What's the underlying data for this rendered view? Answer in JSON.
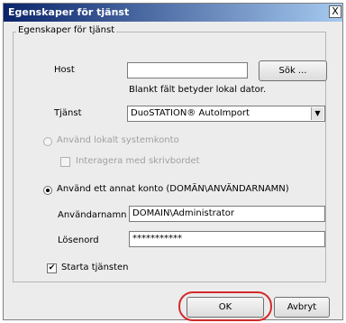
{
  "window": {
    "title": "Egenskaper för tjänst",
    "close_glyph": "X"
  },
  "group": {
    "legend": "Egenskaper för tjänst"
  },
  "host": {
    "label": "Host",
    "value": "",
    "hint": "Blankt fält betyder lokal dator.",
    "browse_button": "Sök ..."
  },
  "service": {
    "label": "Tjänst",
    "selected": "DuoSTATION® AutoImport",
    "arrow_glyph": "▼"
  },
  "account": {
    "local_system_label": "Använd lokalt systemkonto",
    "interact_desktop_label": "Interagera med skrivbordet",
    "other_account_label": "Använd ett annat konto (DOMÄN\\ANVÄNDARNAMN)",
    "username_label": "Användarnamn",
    "username_value": "DOMAIN\\Administrator",
    "password_label": "Lösenord",
    "password_value": "***********"
  },
  "start_service": {
    "label": "Starta tjänsten",
    "checked": true,
    "check_glyph": "✔"
  },
  "footer": {
    "ok_label": "OK",
    "cancel_label": "Avbryt"
  },
  "colors": {
    "titlebar_start": "#0a246a",
    "titlebar_end": "#a6caf0",
    "dialog_bg": "#ececec",
    "highlight_ring": "#d42a2a"
  }
}
